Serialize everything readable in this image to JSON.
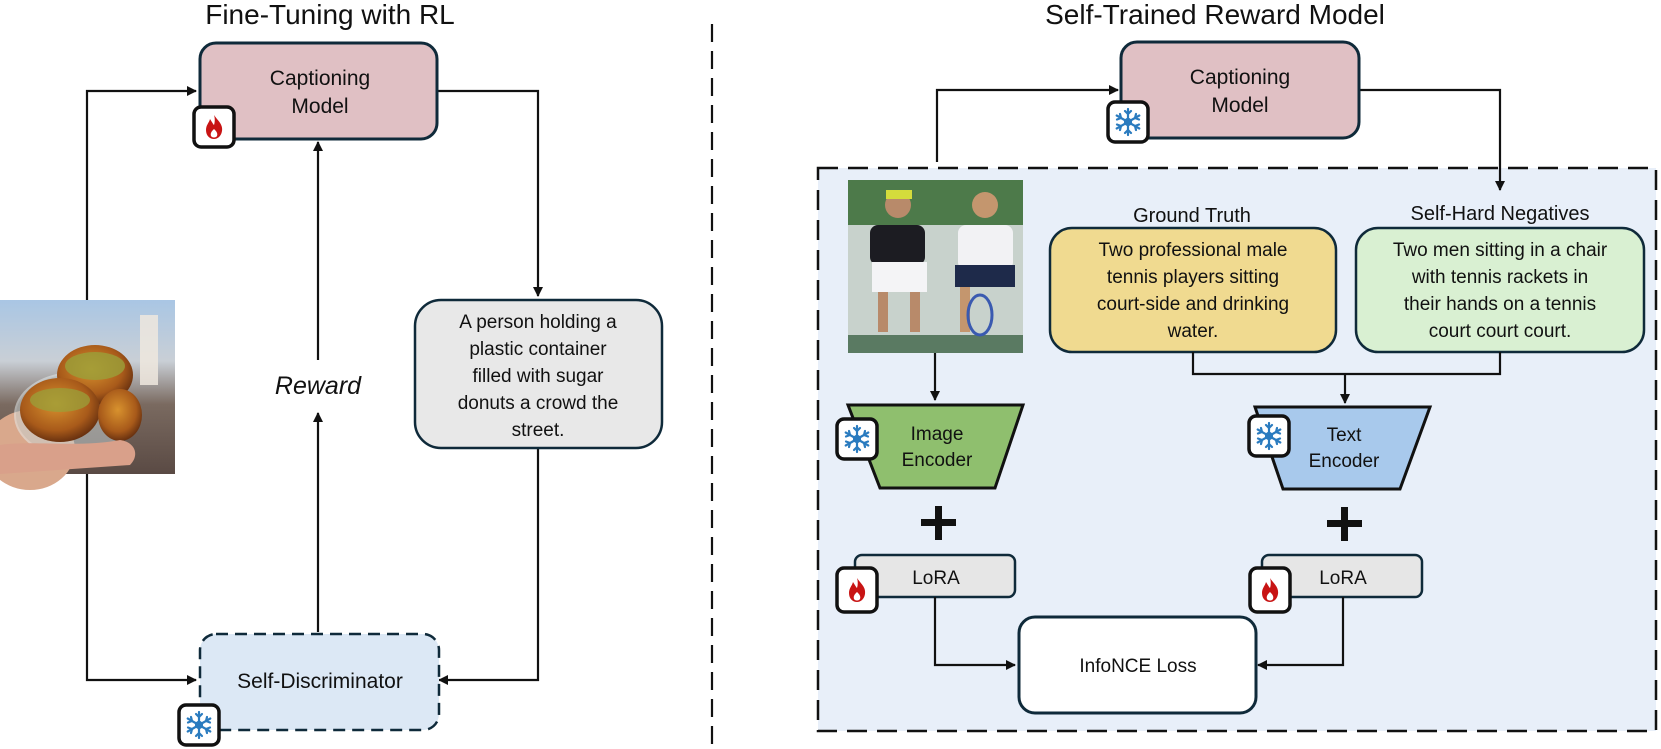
{
  "left_panel": {
    "title": "Fine-Tuning with RL",
    "captioning_model": {
      "line1": "Captioning",
      "line2": "Model",
      "status_icon": "fire-icon"
    },
    "generated_caption": [
      "A person holding a",
      "plastic container",
      "filled with sugar",
      "donuts a crowd the",
      "street."
    ],
    "reward_label": "Reward",
    "self_discriminator": {
      "label": "Self-Discriminator",
      "status_icon": "snowflake-icon"
    },
    "input_image": "donuts-photo"
  },
  "right_panel": {
    "title": "Self-Trained Reward Model",
    "captioning_model": {
      "line1": "Captioning",
      "line2": "Model",
      "status_icon": "snowflake-icon"
    },
    "input_image": "tennis-players-photo",
    "ground_truth": {
      "heading": "Ground Truth",
      "lines": [
        "Two professional male",
        "tennis players sitting",
        "court-side and drinking",
        "water."
      ]
    },
    "self_hard_negatives": {
      "heading": "Self-Hard Negatives",
      "lines": [
        "Two men sitting in a chair",
        "with tennis rackets in",
        "their hands on a tennis",
        "court court court."
      ]
    },
    "image_encoder": {
      "line1": "Image",
      "line2": "Encoder",
      "status_icon": "snowflake-icon"
    },
    "text_encoder": {
      "line1": "Text",
      "line2": "Encoder",
      "status_icon": "snowflake-icon"
    },
    "plus_symbol": "+",
    "lora_left": {
      "label": "LoRA",
      "status_icon": "fire-icon"
    },
    "lora_right": {
      "label": "LoRA",
      "status_icon": "fire-icon"
    },
    "loss": {
      "label": "InfoNCE Loss"
    }
  },
  "colors": {
    "captioning_fill": "#e0c0c4",
    "caption_fill": "#e8e8e8",
    "discriminator_fill": "#dce8f5",
    "panel_fill": "#e8eff9",
    "ground_truth_fill": "#f0da90",
    "negatives_fill": "#d9f0d2",
    "image_encoder_fill": "#8fbf6e",
    "text_encoder_fill": "#a8c9ec",
    "lora_fill": "#e6e6e6",
    "border": "#0f2a3a",
    "fire": "#c81414",
    "snowflake": "#2a7bbf"
  }
}
